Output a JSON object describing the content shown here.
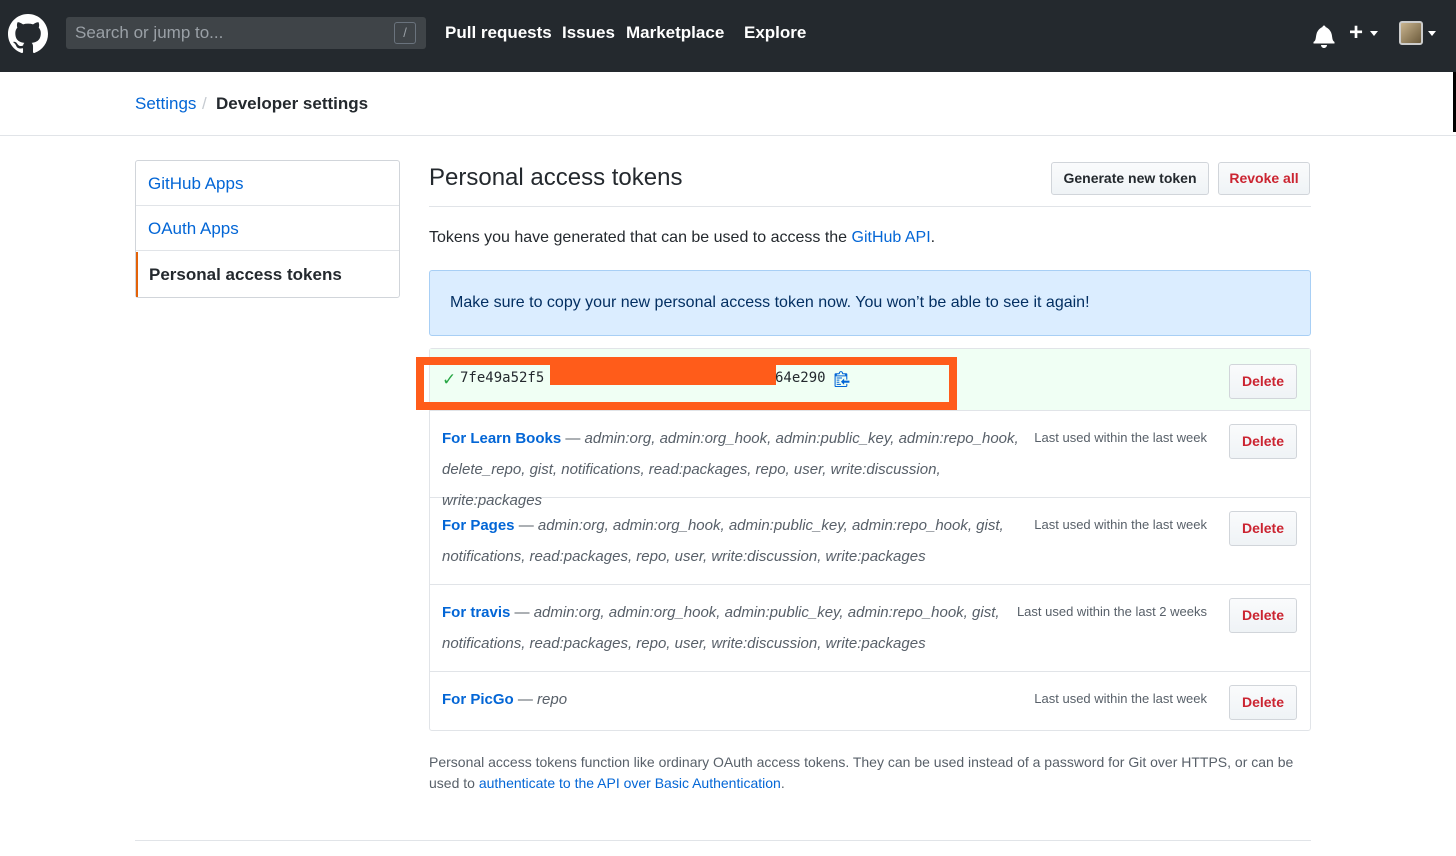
{
  "header": {
    "search_placeholder": "Search or jump to...",
    "search_shortcut": "/",
    "nav": [
      "Pull requests",
      "Issues",
      "Marketplace",
      "Explore"
    ],
    "plus_label": "+"
  },
  "breadcrumb": {
    "parent": "Settings",
    "separator": "/",
    "current": "Developer settings"
  },
  "sidebar": {
    "items": [
      {
        "label": "GitHub Apps"
      },
      {
        "label": "OAuth Apps"
      },
      {
        "label": "Personal access tokens"
      }
    ]
  },
  "main": {
    "title": "Personal access tokens",
    "generate_button": "Generate new token",
    "revoke_all_button": "Revoke all",
    "intro_text": "Tokens you have generated that can be used to access the ",
    "intro_link": "GitHub API",
    "intro_end": ".",
    "flash": "Make sure to copy your new personal access token now. You won’t be able to see it again!",
    "new_token": {
      "check": "✓",
      "prefix": "7fe49a52f5",
      "suffix": "64e290",
      "delete_label": "Delete"
    },
    "tokens": [
      {
        "name": "For Learn Books",
        "dash": " — ",
        "scopes_line1": "admin:org, admin:org_hook, admin:public_key, admin:repo_hook,",
        "scopes_line2": "delete_repo, gist, notifications, read:packages, repo, user, write:discussion, write:packages",
        "last_used": "Last used within the last week",
        "delete_label": "Delete"
      },
      {
        "name": "For Pages",
        "dash": " — ",
        "scopes_line1": "admin:org, admin:org_hook, admin:public_key, admin:repo_hook, gist,",
        "scopes_line2": "notifications, read:packages, repo, user, write:discussion, write:packages",
        "last_used": "Last used within the last week",
        "delete_label": "Delete"
      },
      {
        "name": "For travis",
        "dash": " — ",
        "scopes_line1": "admin:org, admin:org_hook, admin:public_key, admin:repo_hook, gist,",
        "scopes_line2": "notifications, read:packages, repo, user, write:discussion, write:packages",
        "last_used": "Last used within the last 2 weeks",
        "delete_label": "Delete"
      },
      {
        "name": "For PicGo",
        "dash": " — ",
        "scopes_line1": "repo",
        "scopes_line2": "",
        "last_used": "Last used within the last week",
        "delete_label": "Delete"
      }
    ],
    "footnote_text": "Personal access tokens function like ordinary OAuth access tokens. They can be used instead of a password for Git over HTTPS, or can be used to ",
    "footnote_link": "authenticate to the API over Basic Authentication",
    "footnote_end": "."
  },
  "colors": {
    "header_bg": "#24292e",
    "link": "#0366d6",
    "danger": "#cb2431",
    "annotation": "#ff5c1a",
    "flash_bg": "#dbedff",
    "new_token_bg": "#f0fff4"
  }
}
